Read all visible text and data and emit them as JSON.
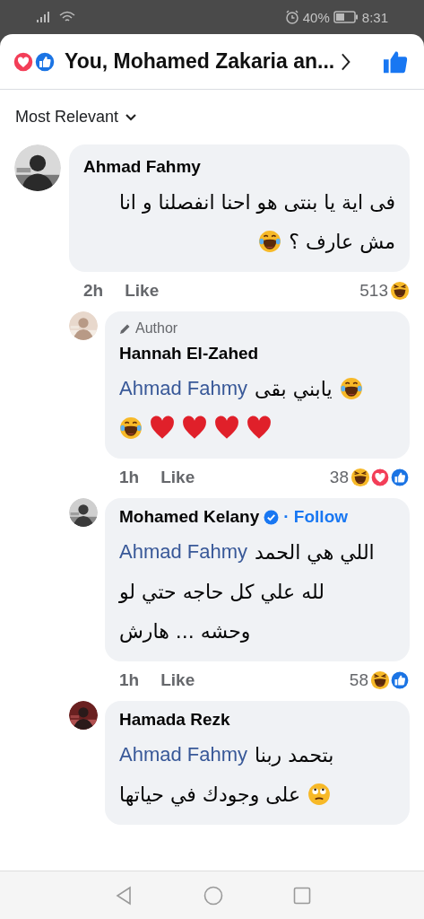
{
  "status_bar": {
    "battery": "40%",
    "time": "8:31"
  },
  "header": {
    "reactions": [
      {
        "kind": "love"
      },
      {
        "kind": "like"
      }
    ],
    "title": "You, Mohamed Zakaria an..."
  },
  "sort": {
    "label": "Most Relevant"
  },
  "comments": [
    {
      "kind": "comment",
      "author": "Ahmad Fahmy",
      "right_aligned": true,
      "lines": [
        [
          {
            "kind": "text",
            "text": "فى اية يا بنتى هو احنا انفصلنا و انا"
          }
        ],
        [
          {
            "kind": "text",
            "text": "مش عارف ؟"
          },
          {
            "kind": "laugh"
          }
        ]
      ],
      "time": "2h",
      "like": "Like",
      "count": "513",
      "reactions": [
        {
          "kind": "haha"
        }
      ]
    },
    {
      "kind": "reply",
      "badge": "Author",
      "author": "Hannah El-Zahed",
      "right_aligned": false,
      "lines": [
        [
          {
            "kind": "laugh"
          },
          {
            "kind": "text",
            "text": "يابني بقى"
          },
          {
            "kind": "mention",
            "text": "Ahmad Fahmy"
          }
        ],
        [
          {
            "kind": "heart"
          },
          {
            "kind": "heart"
          },
          {
            "kind": "heart"
          },
          {
            "kind": "heart"
          },
          {
            "kind": "laugh"
          }
        ]
      ],
      "time": "1h",
      "like": "Like",
      "count": "38",
      "reactions": [
        {
          "kind": "haha"
        },
        {
          "kind": "love"
        },
        {
          "kind": "like"
        }
      ]
    },
    {
      "kind": "reply",
      "author": "Mohamed Kelany",
      "verified": true,
      "follow": "· Follow",
      "right_aligned": false,
      "lines": [
        [
          {
            "kind": "text",
            "text": "اللي هي الحمد"
          },
          {
            "kind": "mention",
            "text": "Ahmad Fahmy"
          }
        ],
        [
          {
            "kind": "text",
            "text": "لله علي كل حاجه حتي لو"
          }
        ],
        [
          {
            "kind": "text",
            "text": "وحشه ... هارش"
          }
        ]
      ],
      "time": "1h",
      "like": "Like",
      "count": "58",
      "reactions": [
        {
          "kind": "haha"
        },
        {
          "kind": "like"
        }
      ]
    },
    {
      "kind": "reply",
      "author": "Hamada Rezk",
      "right_aligned": false,
      "lines": [
        [
          {
            "kind": "text",
            "text": "بتحمد ربنا"
          },
          {
            "kind": "mention",
            "text": "Ahmad Fahmy"
          }
        ],
        [
          {
            "kind": "eyeroll"
          },
          {
            "kind": "text",
            "text": "على وجودك في حياتها"
          }
        ]
      ]
    }
  ]
}
